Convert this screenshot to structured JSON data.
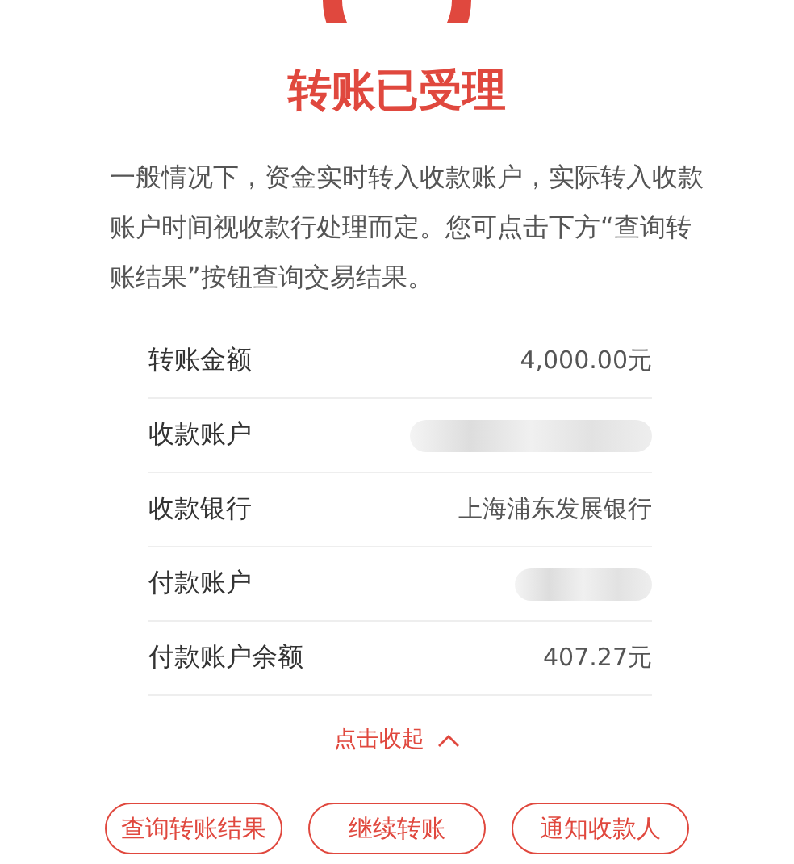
{
  "title": "转账已受理",
  "notice": "一般情况下，资金实时转入收款账户，实际转入收款账户时间视收款行处理而定。您可点击下方“查询转账结果”按钮查询交易结果。",
  "details": [
    {
      "label": "转账金额",
      "kind": "text",
      "value": "4,000.00元"
    },
    {
      "label": "收款账户",
      "kind": "masked"
    },
    {
      "label": "收款银行",
      "kind": "text",
      "value": "上海浦东发展银行"
    },
    {
      "label": "付款账户",
      "kind": "masked"
    },
    {
      "label": "付款账户余额",
      "kind": "text",
      "value": "407.27元"
    }
  ],
  "collapse": {
    "label": "点击收起",
    "expanded": true
  },
  "buttons": [
    "查询转账结果",
    "继续转账",
    "通知收款人"
  ]
}
